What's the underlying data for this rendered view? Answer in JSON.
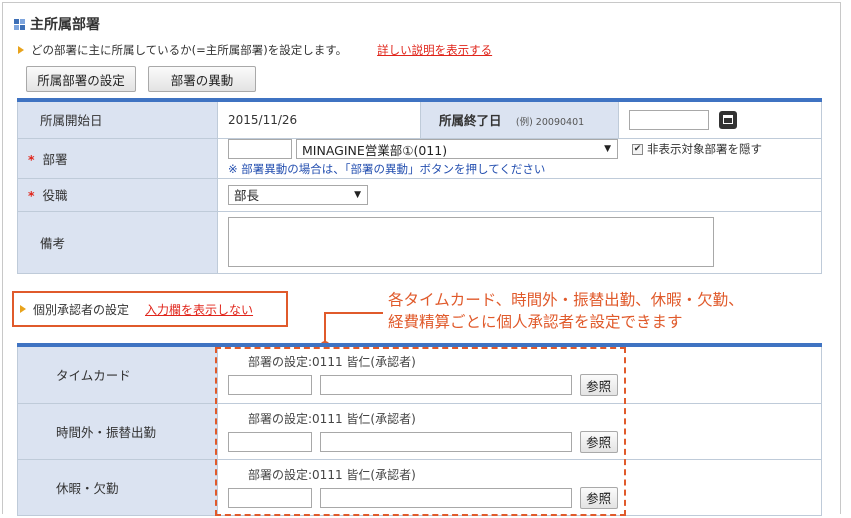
{
  "section": {
    "title": "主所属部署"
  },
  "description": {
    "text": "どの部署に主に所属しているか(=主所属部署)を設定します。",
    "link": "詳しい説明を表示する"
  },
  "buttons": {
    "main_dept_setting": "所属部署の設定",
    "dept_transfer": "部署の異動"
  },
  "form": {
    "start_date": {
      "label": "所属開始日",
      "value": "2015/11/26"
    },
    "end_date": {
      "label": "所属終了日",
      "hint": "(例) 20090401",
      "value": ""
    },
    "dept": {
      "required_mark": "*",
      "label": "部署",
      "code_value": "",
      "selected": "MINAGINE営業部①(011)",
      "hide_checkbox_label": "非表示対象部署を隠す",
      "hide_checkbox_checked": true,
      "note": "※ 部署異動の場合は、「部署の異動」ボタンを押してください"
    },
    "position": {
      "required_mark": "*",
      "label": "役職",
      "selected": "部長"
    },
    "remarks": {
      "label": "備考",
      "value": ""
    }
  },
  "individual_approver": {
    "label": "個別承認者の設定",
    "link": "入力欄を表示しない"
  },
  "callout": {
    "line1": "各タイムカード、時間外・振替出勤、休暇・欠勤、",
    "line2": "経費精算ごとに個人承認者を設定できます"
  },
  "approvers": [
    {
      "label": "タイムカード",
      "dept_setting": "部署の設定:0111 皆仁(承認者)",
      "button": "参照"
    },
    {
      "label": "時間外・振替出勤",
      "dept_setting": "部署の設定:0111 皆仁(承認者)",
      "button": "参照"
    },
    {
      "label": "休暇・欠勤",
      "dept_setting": "部署の設定:0111 皆仁(承認者)",
      "button": "参照"
    }
  ],
  "colors": {
    "accent_blue": "#3f73c2",
    "label_bg": "#dbe3f1",
    "required_red": "#e0251b",
    "callout_orange": "#e05a2b"
  },
  "icons": {
    "section": "grid-icon",
    "calendar": "calendar-icon",
    "bullet": "triangle-bullet-icon"
  }
}
